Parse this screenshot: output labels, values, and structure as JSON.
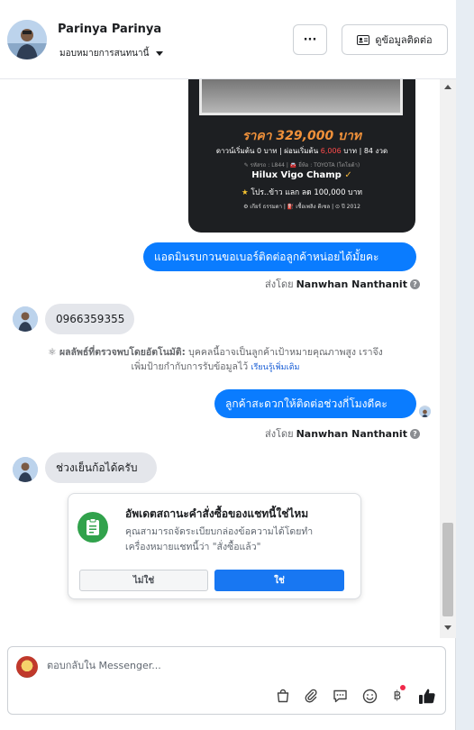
{
  "header": {
    "name": "Parinya Parinya",
    "assign_label": "มอบหมายการสนทนานี้",
    "more_label": "···",
    "contact_label": "ดูข้อมูลติดต่อ"
  },
  "ad_image": {
    "price": "ราคา 329,000 บาท",
    "down_prefix": "ดาวน์เริ่มต้น 0 บาท | ผ่อนเริ่มต้น",
    "down_amount": "6,006",
    "down_suffix": "บาท | 84 งวด",
    "meta": "✎ รหัสรถ : L844 | 🚘 ยี่ห้อ : TOYOTA (โตโยต้า)",
    "model": "Hilux Vigo Champ",
    "promo": "โปร..ข้าว แลก ลด 100,000 บาท",
    "footer": "⚙ เกียร์ ธรรมดา   |   ⛽ เชื้อเพลิง ดีเซล   |   ⊙ ปี 2012"
  },
  "messages": [
    {
      "direction": "out",
      "text": "แอดมินรบกวนขอเบอร์ติดต่อลูกค้าหน่อยได้มั้ยคะ",
      "sent_by_prefix": "ส่งโดย",
      "sent_by_name": "Nanwhan Nanthanit"
    },
    {
      "direction": "in",
      "text": "0966359355"
    },
    {
      "direction": "out",
      "text": "ลูกค้าสะดวกให้ติดต่อช่วงกี่โมงดีคะ",
      "sent_by_prefix": "ส่งโดย",
      "sent_by_name": "Nanwhan Nanthanit"
    },
    {
      "direction": "in",
      "text": "ช่วงเย็นก้อได้ครับ"
    }
  ],
  "auto_detect": {
    "label": "ผลลัพธ์ที่ตรวจพบโดยอัตโนมัติ:",
    "text_line1": "บุคคลนี้อาจเป็นลูกค้าเป้าหมายคุณภาพสูง เราจึง",
    "text_line2": "เพิ่มป้ายกำกับการรับข้อมูลไว้",
    "link": "เรียนรู้เพิ่มเติม"
  },
  "status_card": {
    "title": "อัพเดตสถานะคำสั่งซื้อของแชทนี้ใช่ไหม",
    "desc_line1": "คุณสามารถจัดระเบียบกล่องข้อความได้โดยทำ",
    "desc_line2": "เครื่องหมายแชทนี้ว่า \"สั่งซื้อแล้ว\"",
    "no_label": "ไม่ใช่",
    "yes_label": "ใช่"
  },
  "composer": {
    "placeholder": "ตอบกลับใน Messenger...",
    "baht_symbol": "฿"
  },
  "colors": {
    "outgoing_bubble": "#0a7cff",
    "incoming_bubble": "#e4e6eb",
    "primary_button": "#1877f2",
    "card_icon": "#31a24c",
    "like": "#1c1e21"
  }
}
